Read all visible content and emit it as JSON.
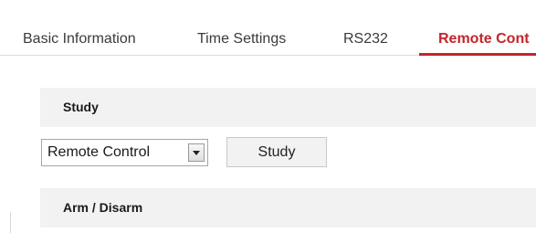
{
  "tabs": [
    {
      "label": "Basic Information",
      "active": false
    },
    {
      "label": "Time Settings",
      "active": false
    },
    {
      "label": "RS232",
      "active": false
    },
    {
      "label": "Remote Cont",
      "active": true
    }
  ],
  "accent_color": "#c4252b",
  "study": {
    "section_title": "Study",
    "select_value": "Remote Control",
    "button_label": "Study"
  },
  "arm_disarm": {
    "section_title": "Arm / Disarm"
  }
}
